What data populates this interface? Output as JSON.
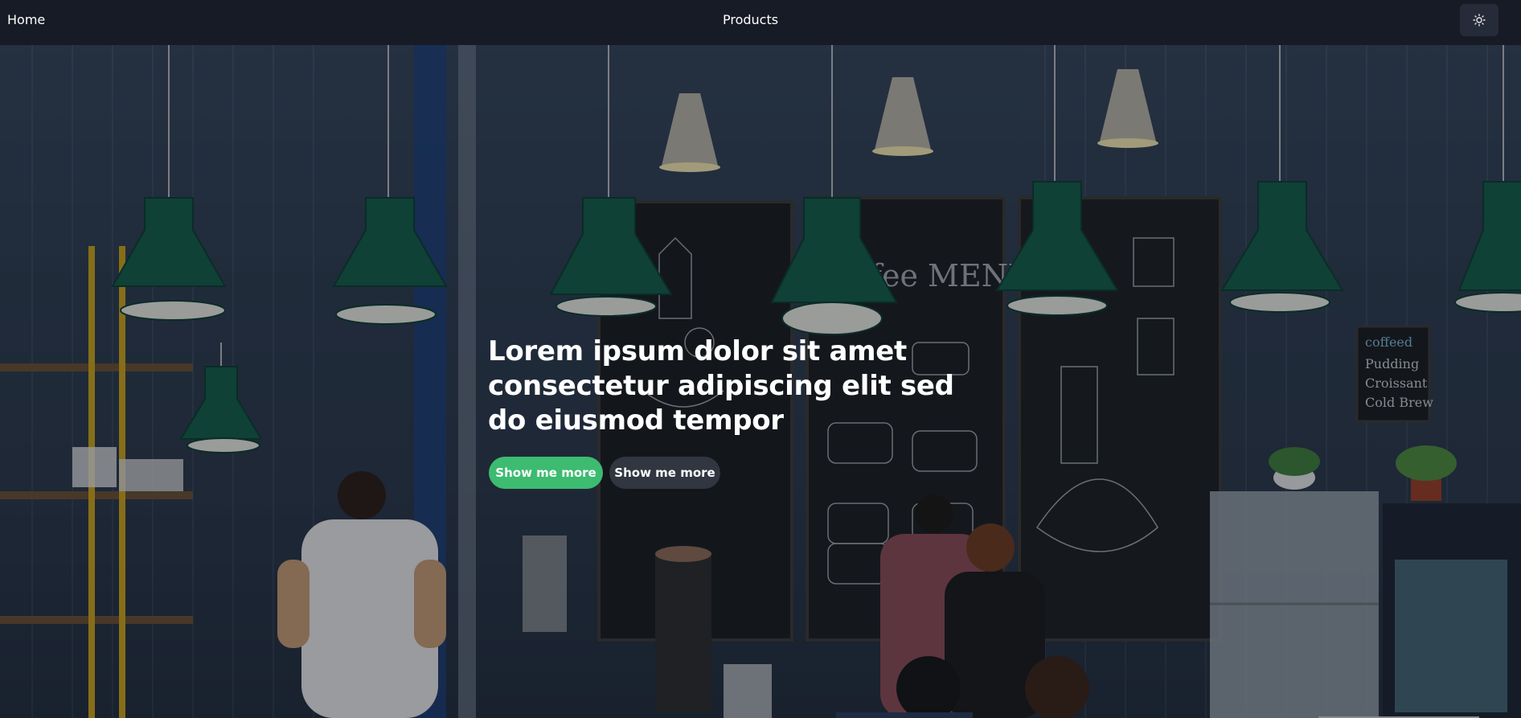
{
  "nav": {
    "home_label": "Home",
    "products_label": "Products",
    "theme_toggle_icon": "sun-icon"
  },
  "hero": {
    "headline": "Lorem ipsum dolor sit amet consectetur adipiscing elit sed do eiusmod tempor",
    "primary_button": "Show me more",
    "secondary_button": "Show me more",
    "primary_color": "#3dbb70",
    "background_image": "coffee-shop-photo"
  }
}
